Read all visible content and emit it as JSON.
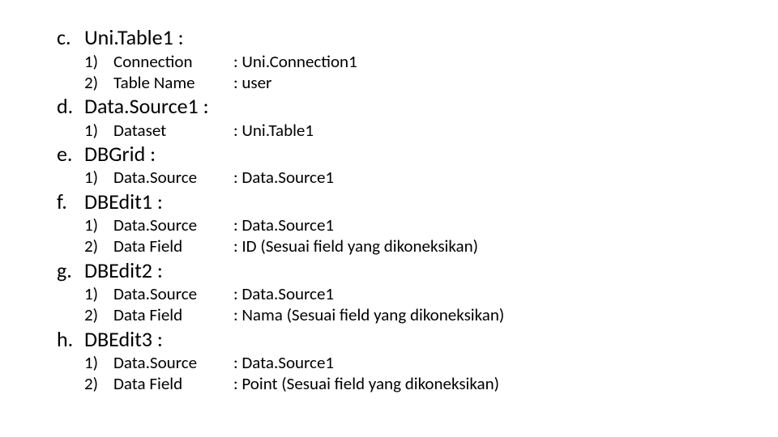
{
  "sections": [
    {
      "letter": "c.",
      "title": "Uni.Table1 :",
      "items": [
        {
          "num": "1)",
          "label": "Connection",
          "value": ": Uni.Connection1"
        },
        {
          "num": "2)",
          "label": "Table Name",
          "value": ": user"
        }
      ]
    },
    {
      "letter": "d.",
      "title": "Data.Source1 :",
      "items": [
        {
          "num": "1)",
          "label": "Dataset",
          "value": ": Uni.Table1"
        }
      ]
    },
    {
      "letter": "e.",
      "title": "DBGrid :",
      "items": [
        {
          "num": "1)",
          "label": "Data.Source",
          "value": ": Data.Source1"
        }
      ]
    },
    {
      "letter": "f.",
      "title": "DBEdit1 :",
      "items": [
        {
          "num": "1)",
          "label": "Data.Source",
          "value": ": Data.Source1"
        },
        {
          "num": "2)",
          "label": "Data Field",
          "value": ": ID (Sesuai field yang dikoneksikan)"
        }
      ]
    },
    {
      "letter": "g.",
      "title": "DBEdit2 :",
      "items": [
        {
          "num": "1)",
          "label": "Data.Source",
          "value": ": Data.Source1"
        },
        {
          "num": "2)",
          "label": "Data Field",
          "value": ": Nama (Sesuai field yang dikoneksikan)"
        }
      ]
    },
    {
      "letter": "h.",
      "title": "DBEdit3 :",
      "items": [
        {
          "num": "1)",
          "label": "Data.Source",
          "value": ": Data.Source1"
        },
        {
          "num": "2)",
          "label": "Data Field",
          "value": ": Point (Sesuai field yang dikoneksikan)"
        }
      ]
    }
  ]
}
